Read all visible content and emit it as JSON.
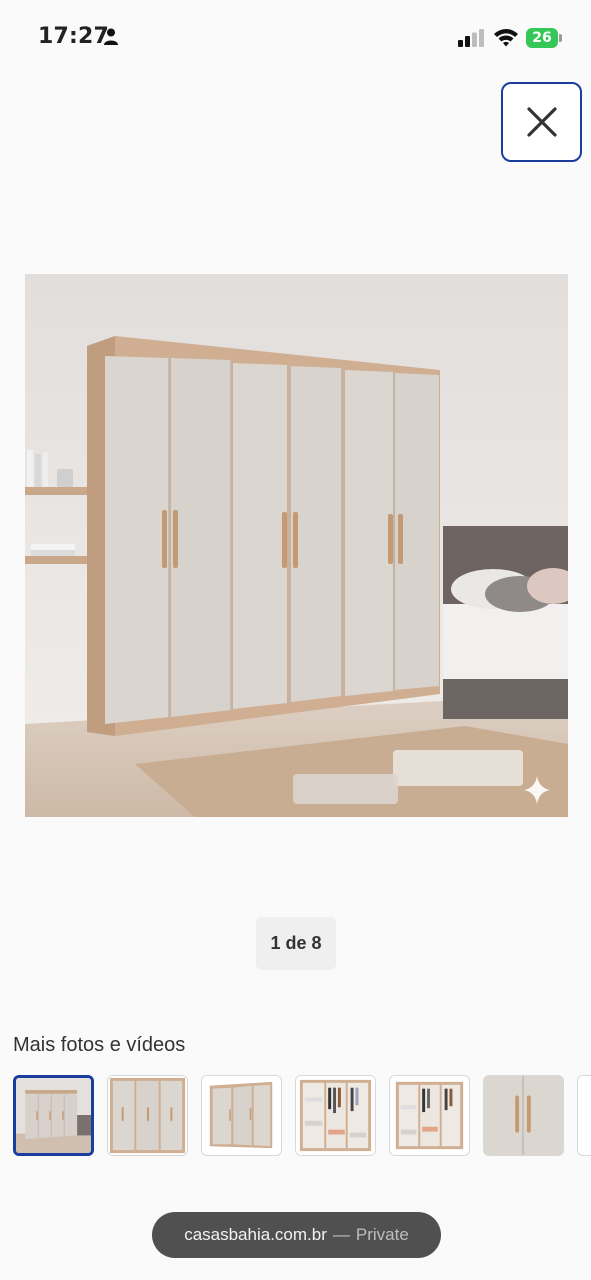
{
  "status_bar": {
    "time": "17:27",
    "battery_level": "26",
    "battery_color": "#36c759"
  },
  "icons": {
    "close": "close-icon",
    "person": "person-icon",
    "signal": "cellular-signal-icon",
    "wifi": "wifi-icon",
    "sparkle": "sparkle-icon"
  },
  "gallery": {
    "counter": "1 de 8",
    "current_index": 1,
    "total": 8
  },
  "more_media": {
    "title": "Mais fotos e vídeos",
    "thumbnails": [
      {
        "name": "thumbnail-1",
        "selected": true
      },
      {
        "name": "thumbnail-2",
        "selected": false
      },
      {
        "name": "thumbnail-3",
        "selected": false
      },
      {
        "name": "thumbnail-4",
        "selected": false
      },
      {
        "name": "thumbnail-5",
        "selected": false
      },
      {
        "name": "thumbnail-6",
        "selected": false
      }
    ]
  },
  "browser": {
    "domain": "casasbahia.com.br",
    "separator": "—",
    "mode": "Private"
  },
  "colors": {
    "accent": "#1b3d9e",
    "background": "#fafafa"
  }
}
